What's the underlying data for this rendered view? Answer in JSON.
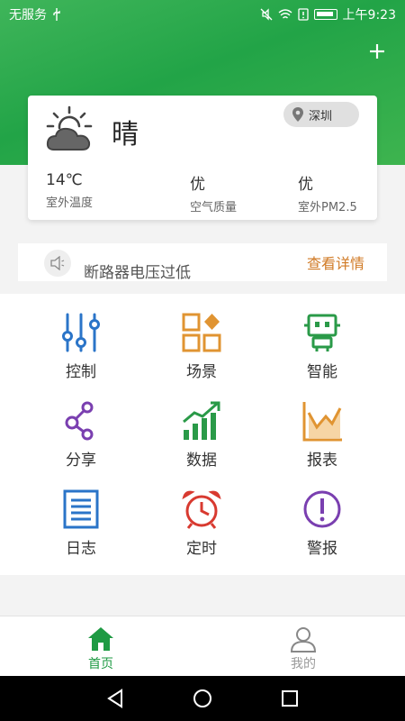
{
  "status_bar": {
    "carrier": "无服务",
    "time": "上午9:23"
  },
  "header": {
    "add_icon": "plus-icon"
  },
  "weather": {
    "condition": "晴",
    "icon": "partly-sunny-cloud-icon",
    "location": "深圳",
    "metrics": [
      {
        "value": "14℃",
        "label": "室外温度"
      },
      {
        "value": "优",
        "label": "空气质量"
      },
      {
        "value": "优",
        "label": "室外PM2.5"
      }
    ]
  },
  "notice": {
    "text": "断路器电压过低",
    "link": "查看详情",
    "link_color": "#d07a25"
  },
  "grid": {
    "items": [
      {
        "label": "控制",
        "icon": "control-sliders-icon",
        "color": "#2a74c8"
      },
      {
        "label": "场景",
        "icon": "scene-blocks-icon",
        "color": "#e09432"
      },
      {
        "label": "智能",
        "icon": "robot-icon",
        "color": "#2a9a48"
      },
      {
        "label": "分享",
        "icon": "share-nodes-icon",
        "color": "#7a3fb0"
      },
      {
        "label": "数据",
        "icon": "data-bars-icon",
        "color": "#2a9a48"
      },
      {
        "label": "报表",
        "icon": "report-chart-icon",
        "color": "#e09432"
      },
      {
        "label": "日志",
        "icon": "log-document-icon",
        "color": "#2a74c8"
      },
      {
        "label": "定时",
        "icon": "alarm-clock-icon",
        "color": "#d83a30"
      },
      {
        "label": "警报",
        "icon": "alert-icon",
        "color": "#7a3fb0"
      }
    ]
  },
  "bottom_nav": {
    "items": [
      {
        "label": "首页",
        "icon": "home-icon",
        "active": true
      },
      {
        "label": "我的",
        "icon": "user-icon",
        "active": false
      }
    ],
    "active_color": "#1e9a43",
    "inactive_color": "#999999"
  }
}
